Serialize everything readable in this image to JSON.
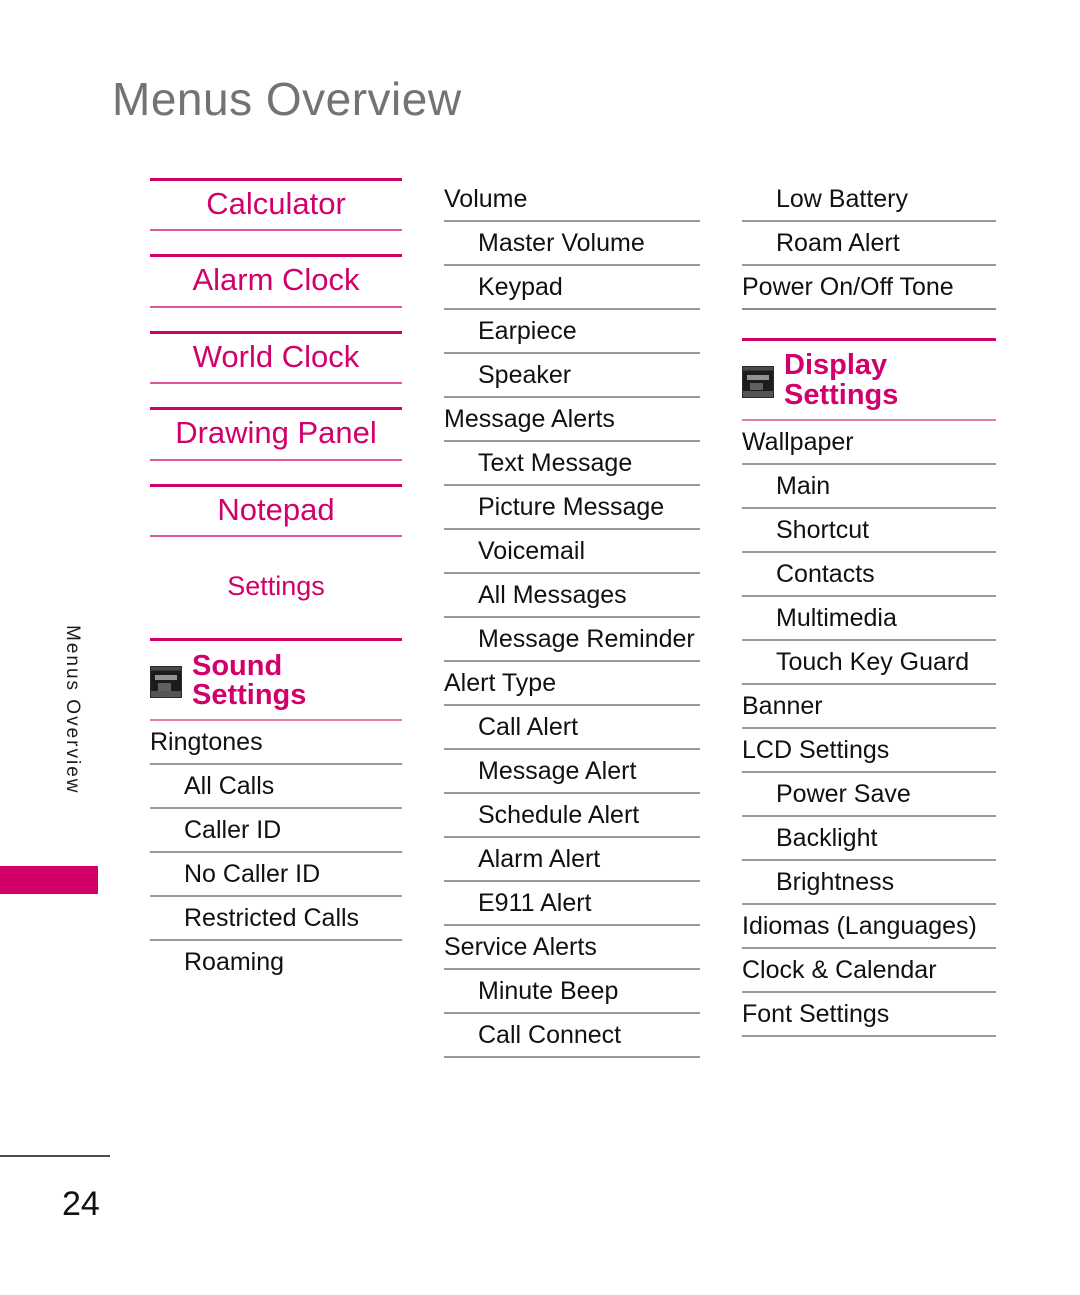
{
  "page": {
    "title": "Menus Overview",
    "side_label": "Menus Overview",
    "page_number": "24",
    "accent_color": "#d2006b",
    "title_color": "#737373",
    "rule_color": "#9a9a9a"
  },
  "column1": {
    "big_items": [
      {
        "label": "Calculator"
      },
      {
        "label": "Alarm Clock"
      },
      {
        "label": "World Clock"
      },
      {
        "label": "Drawing Panel"
      },
      {
        "label": "Notepad"
      }
    ],
    "plain_header": "Settings",
    "section": {
      "icon": "sound-settings-thumbnail-icon",
      "title": "Sound\nSettings"
    },
    "rows": [
      {
        "label": "Ringtones",
        "level": 1
      },
      {
        "label": "All Calls",
        "level": 2
      },
      {
        "label": "Caller ID",
        "level": 2
      },
      {
        "label": "No Caller ID",
        "level": 2
      },
      {
        "label": "Restricted Calls",
        "level": 2
      },
      {
        "label": "Roaming",
        "level": 2
      }
    ]
  },
  "column2": {
    "rows": [
      {
        "label": "Volume",
        "level": 1
      },
      {
        "label": "Master Volume",
        "level": 2
      },
      {
        "label": "Keypad",
        "level": 2
      },
      {
        "label": "Earpiece",
        "level": 2
      },
      {
        "label": "Speaker",
        "level": 2
      },
      {
        "label": "Message Alerts",
        "level": 1
      },
      {
        "label": "Text Message",
        "level": 2
      },
      {
        "label": "Picture Message",
        "level": 2
      },
      {
        "label": "Voicemail",
        "level": 2
      },
      {
        "label": "All Messages",
        "level": 2
      },
      {
        "label": "Message Reminder",
        "level": 2
      },
      {
        "label": "Alert Type",
        "level": 1
      },
      {
        "label": "Call Alert",
        "level": 2
      },
      {
        "label": "Message Alert",
        "level": 2
      },
      {
        "label": "Schedule Alert",
        "level": 2
      },
      {
        "label": "Alarm Alert",
        "level": 2
      },
      {
        "label": "E911  Alert",
        "level": 2
      },
      {
        "label": "Service Alerts",
        "level": 1
      },
      {
        "label": "Minute Beep",
        "level": 2
      },
      {
        "label": "Call Connect",
        "level": 2
      }
    ]
  },
  "column3": {
    "rows_top": [
      {
        "label": "Low Battery",
        "level": 2
      },
      {
        "label": "Roam Alert",
        "level": 2
      },
      {
        "label": "Power On/Off Tone",
        "level": 1
      }
    ],
    "section": {
      "icon": "display-settings-thumbnail-icon",
      "title": "Display\nSettings"
    },
    "rows_bottom": [
      {
        "label": "Wallpaper",
        "level": 1
      },
      {
        "label": "Main",
        "level": 2
      },
      {
        "label": "Shortcut",
        "level": 2
      },
      {
        "label": "Contacts",
        "level": 2
      },
      {
        "label": "Multimedia",
        "level": 2
      },
      {
        "label": "Touch Key Guard",
        "level": 2
      },
      {
        "label": "Banner",
        "level": 1
      },
      {
        "label": "LCD Settings",
        "level": 1
      },
      {
        "label": "Power Save",
        "level": 2
      },
      {
        "label": "Backlight",
        "level": 2
      },
      {
        "label": "Brightness",
        "level": 2
      },
      {
        "label": "Idiomas (Languages)",
        "level": 1
      },
      {
        "label": "Clock & Calendar",
        "level": 1
      },
      {
        "label": "Font Settings",
        "level": 1
      }
    ]
  }
}
